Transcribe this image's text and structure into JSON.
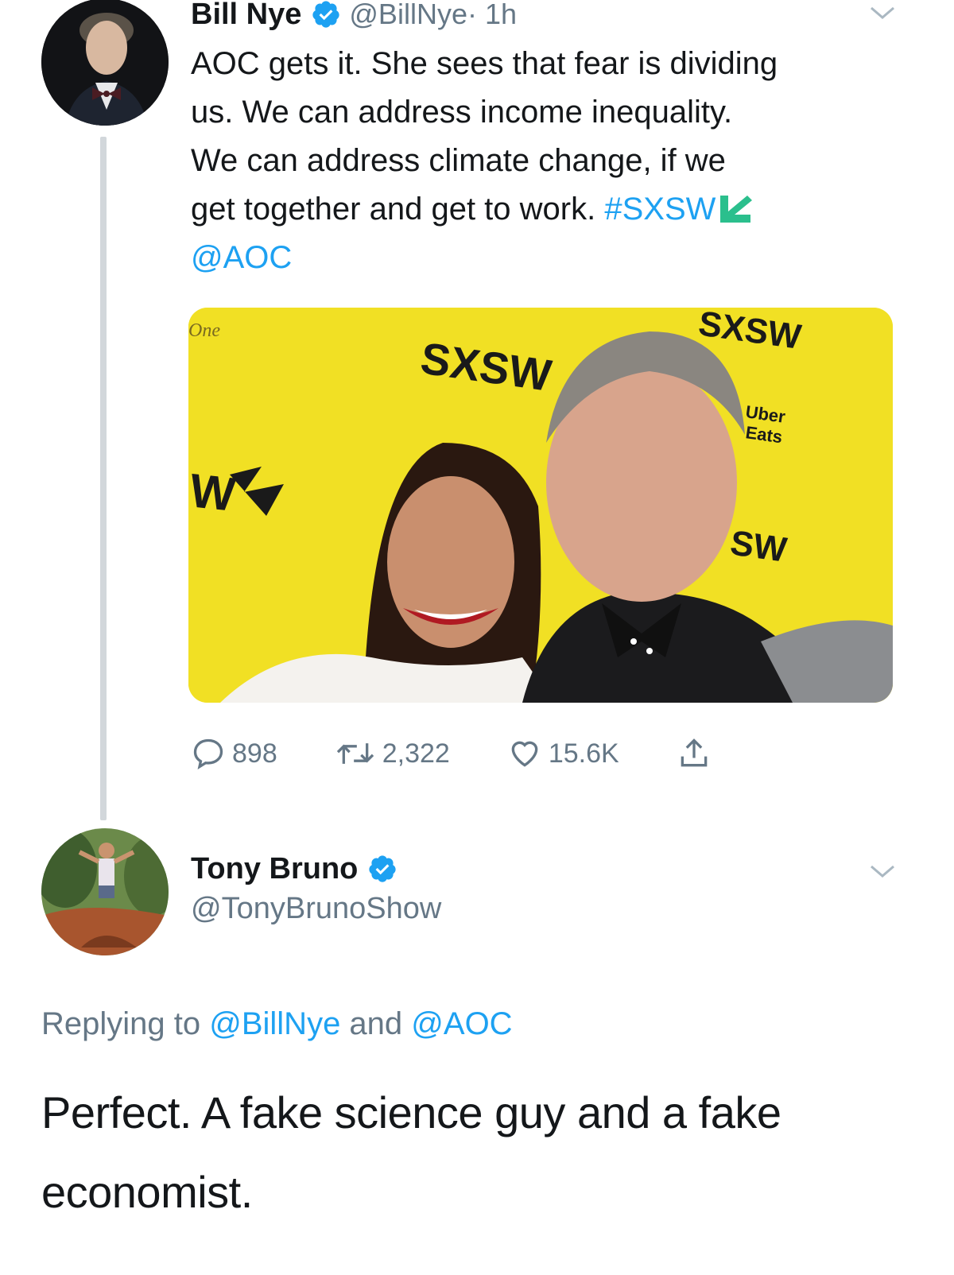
{
  "tweet": {
    "author_name": "Bill Nye",
    "author_handle": "@BillNye",
    "time": " · 1h",
    "lines": [
      "AOC gets it. She sees that fear is dividing",
      "us. We can address income inequality.",
      "We can address climate change, if we",
      "get together and get to work. "
    ],
    "hashtag": "#SXSW",
    "mention": "@AOC",
    "photo": {
      "backdrop_color": "#f2e221",
      "signs": {
        "sxsw": "SXSW",
        "one": "One",
        "uber": "Uber",
        "eats": "Eats",
        "brand_top": "SXSW",
        "brand_left": "W",
        "brand_right": "SW"
      }
    },
    "actions": {
      "replies": "898",
      "retweets": "2,322",
      "likes": "15.6K"
    }
  },
  "reply": {
    "author_name": "Tony Bruno",
    "author_handle": "@TonyBrunoShow",
    "replying_prefix": "Replying to ",
    "replying_user1": "@BillNye",
    "replying_and": " and ",
    "replying_user2": "@AOC",
    "text_line1": "Perfect. A fake science guy and a fake",
    "text_line2": "economist."
  },
  "colors": {
    "link": "#1da1f2",
    "secondary_text": "#657786",
    "verified": "#1da1f2",
    "sxsw_green": "#2bbf8d"
  }
}
